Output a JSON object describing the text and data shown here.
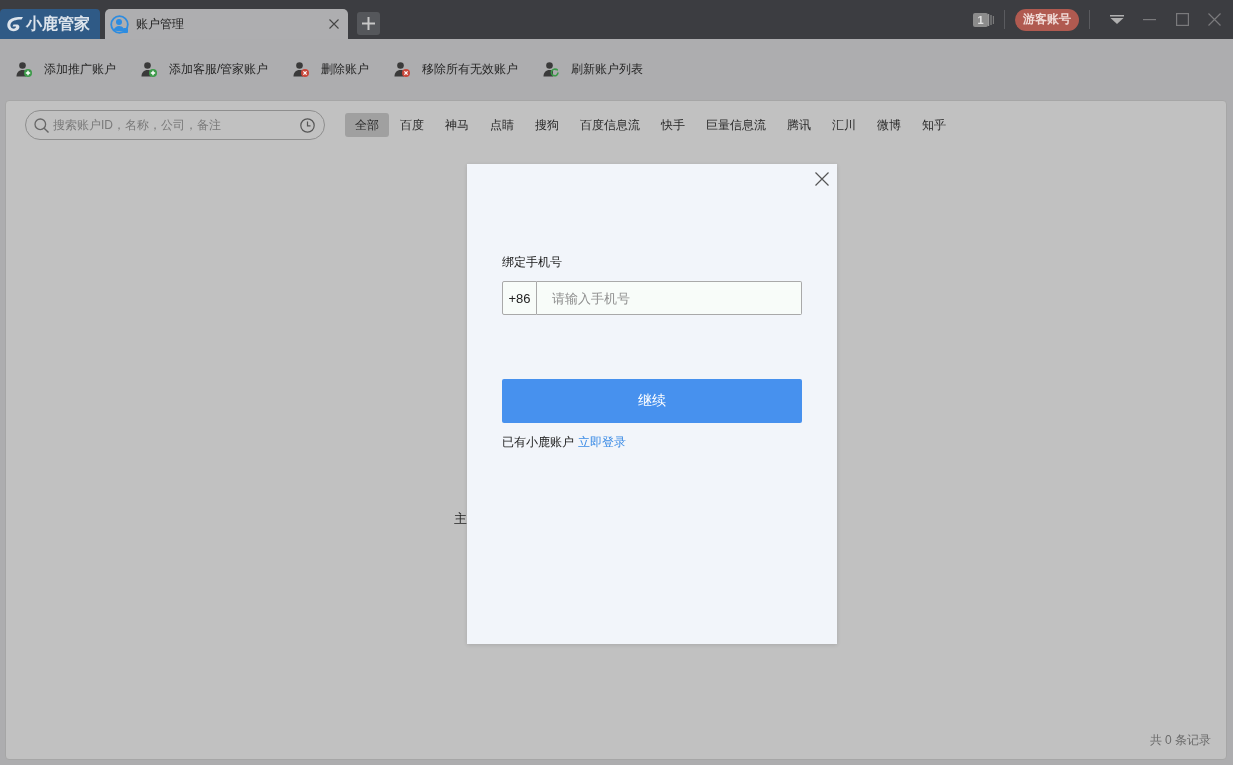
{
  "app": {
    "logo_text": "小鹿管家"
  },
  "tabs": [
    {
      "label": "账户管理",
      "selected": true
    }
  ],
  "title_bar": {
    "notification_count": "1",
    "account_badge": "游客账号"
  },
  "toolbar": [
    {
      "label": "添加推广账户",
      "kind": "add"
    },
    {
      "label": "添加客服/管家账户",
      "kind": "add"
    },
    {
      "label": "删除账户",
      "kind": "remove"
    },
    {
      "label": "移除所有无效账户",
      "kind": "remove"
    },
    {
      "label": "刷新账户列表",
      "kind": "refresh"
    }
  ],
  "search": {
    "placeholder": "搜索账户ID，名称，公司，备注"
  },
  "filters": [
    {
      "label": "全部",
      "selected": true
    },
    {
      "label": "百度",
      "selected": false
    },
    {
      "label": "神马",
      "selected": false
    },
    {
      "label": "点睛",
      "selected": false
    },
    {
      "label": "搜狗",
      "selected": false
    },
    {
      "label": "百度信息流",
      "selected": false
    },
    {
      "label": "快手",
      "selected": false
    },
    {
      "label": "巨量信息流",
      "selected": false
    },
    {
      "label": "腾讯",
      "selected": false
    },
    {
      "label": "汇川",
      "selected": false
    },
    {
      "label": "微博",
      "selected": false
    },
    {
      "label": "知乎",
      "selected": false
    }
  ],
  "empty_state": {
    "message": "主"
  },
  "footer": {
    "record_count": "共 0 条记录"
  },
  "dialog": {
    "field_label": "绑定手机号",
    "phone_field": {
      "prefix": "+86",
      "placeholder": "请输入手机号"
    },
    "submit": "继续",
    "login_prompt": "已有小鹿账户",
    "login_link": "立即登录"
  }
}
